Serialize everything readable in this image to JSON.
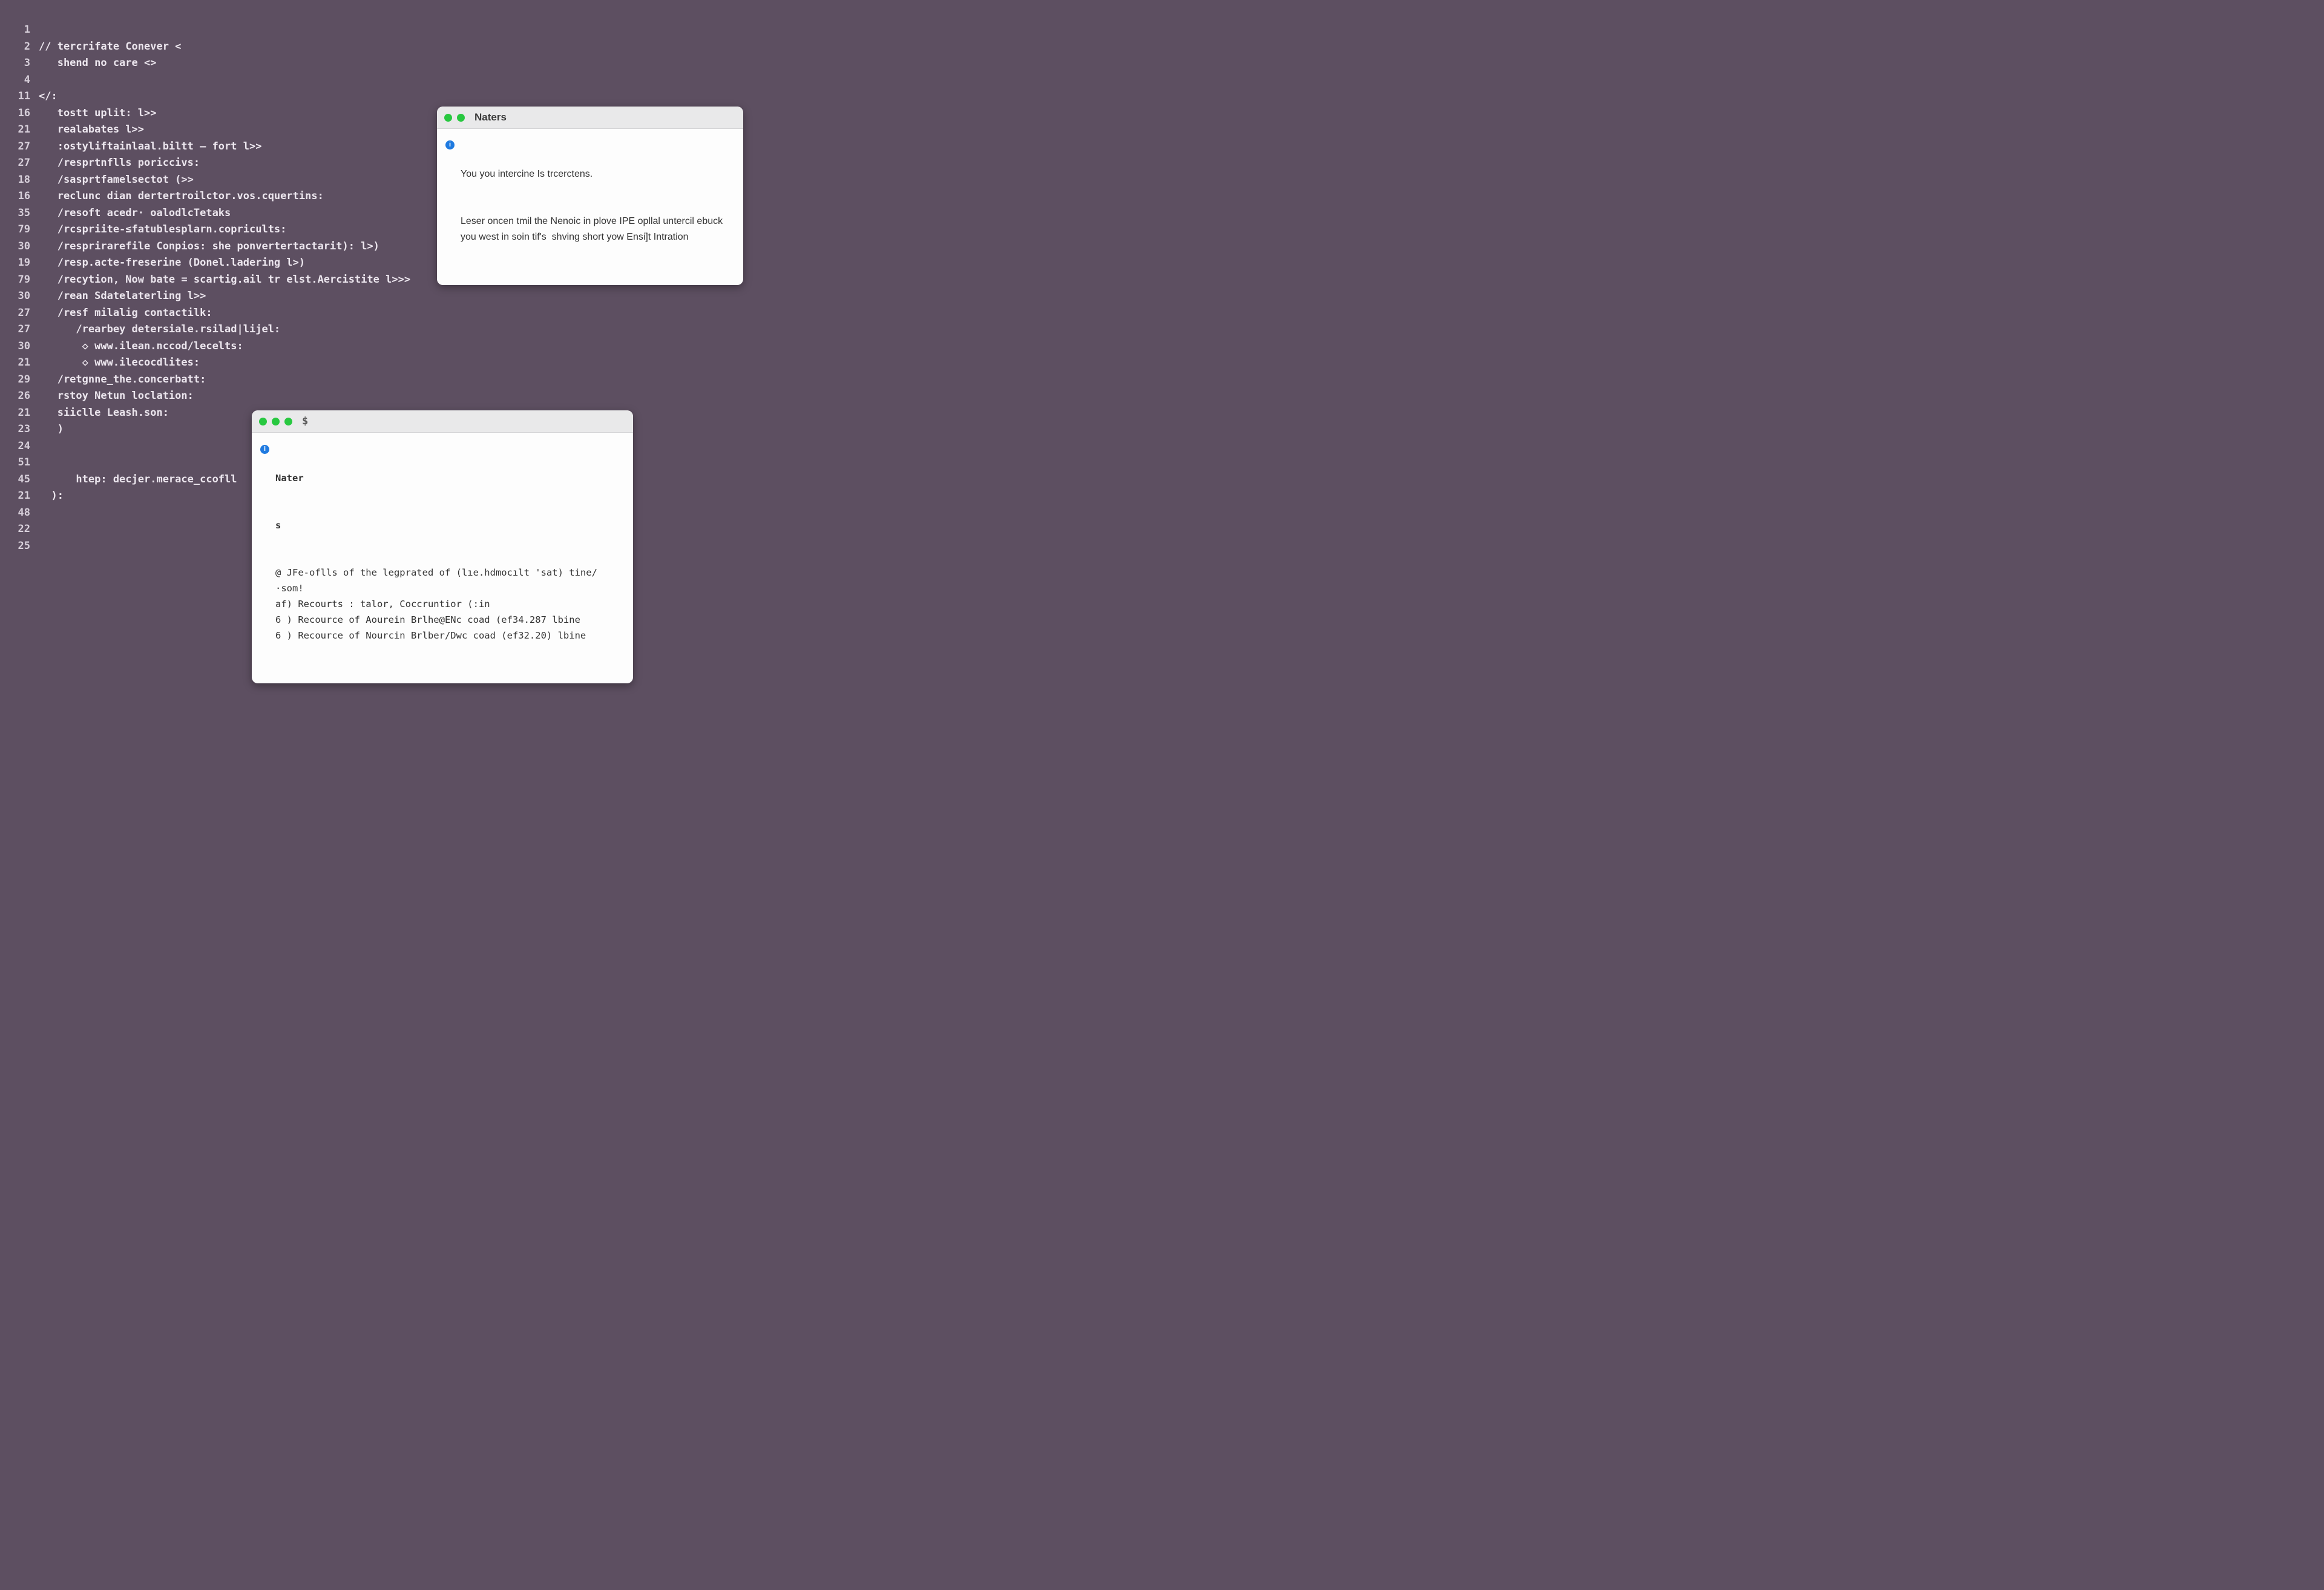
{
  "editor": {
    "lines": [
      {
        "n": "1",
        "text": ""
      },
      {
        "n": "2",
        "text": "// tercrifate Conever <"
      },
      {
        "n": "3",
        "text": "   shend no care <>"
      },
      {
        "n": "4",
        "text": ""
      },
      {
        "n": "11",
        "text": "</:"
      },
      {
        "n": "16",
        "text": "   tostt uplit: l>>"
      },
      {
        "n": "21",
        "text": "   realabates l>>"
      },
      {
        "n": "27",
        "text": "   :ostyliftainlaal.biltt – fort l>>"
      },
      {
        "n": "27",
        "text": "   /resprtnflls poriccivs:"
      },
      {
        "n": "18",
        "text": "   /sasprtfamelsectot (>>"
      },
      {
        "n": "16",
        "text": "   reclunc dian dertertroilctor.vos.cquertins:"
      },
      {
        "n": "35",
        "text": "   /resoft acedr· oalodlcTetaks"
      },
      {
        "n": "79",
        "text": "   /rcspriite-≤fatublesplarn.copricults:"
      },
      {
        "n": "30",
        "text": "   /resprirarefile Conpios: she ponvertertactarit): l>)"
      },
      {
        "n": "19",
        "text": "   /resp.acte-freserine (Donel.ladering l>)"
      },
      {
        "n": "79",
        "text": "   /recytion, Now bate = scartig.ail tr elst.Aercistite l>>>"
      },
      {
        "n": "30",
        "text": "   /rean Sdatelaterling l>>"
      },
      {
        "n": "27",
        "text": "   /resf milalig contactilk:"
      },
      {
        "n": "27",
        "text": "      /rearbey detersiale.rsilad|lijel:"
      },
      {
        "n": "30",
        "text": "       ◇ www.ilean.nccod/lecelts:"
      },
      {
        "n": "21",
        "text": "       ◇ www.ilecocdlites:"
      },
      {
        "n": "29",
        "text": "   /retgnne_the.concerbatt:"
      },
      {
        "n": "26",
        "text": "   rstoy Netun loclation:"
      },
      {
        "n": "21",
        "text": "   siiclle Leash.son:"
      },
      {
        "n": "23",
        "text": "   )"
      },
      {
        "n": "24",
        "text": ""
      },
      {
        "n": "51",
        "text": ""
      },
      {
        "n": "45",
        "text": "      htep: decjer.merace_ccofll"
      },
      {
        "n": "21",
        "text": "  ):"
      },
      {
        "n": "48",
        "text": ""
      },
      {
        "n": "22",
        "text": ""
      },
      {
        "n": "25",
        "text": ""
      }
    ]
  },
  "panel_naters": {
    "title": "Naters",
    "info_glyph": "i",
    "line1": "You you intercine Is trcerctens.",
    "body": "Leser oncen tmil the Nenoic in plove IPE opllal untercil ebuck you west in soin tif's  shving short yow Ensi]t Intration"
  },
  "panel_terminal": {
    "prompt": "$",
    "info_glyph": "i",
    "header": "Nater",
    "header2": "s",
    "rows": [
      "@ JFe-oflls of the legprated of (lıe.hdmocılt 'sat) tine/·som!",
      "af) Recourts : talor, Coccruntior (:in",
      "6 ) Recource of Aourein Brlhe@ENc coad (ef34.287 lbine",
      "6 ) Recource of Nourcin Brlber/Dwc coad (ef32.20) lbine"
    ]
  }
}
